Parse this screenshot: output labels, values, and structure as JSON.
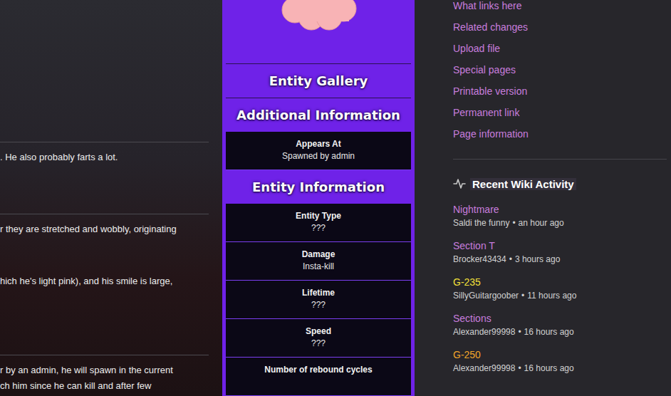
{
  "article": {
    "sections": [
      {
        "lines": [
          ". He also probably farts a lot."
        ]
      },
      {
        "lines": [
          "r they are stretched and wobbly, originating",
          "hich he's light pink), and his smile is large,"
        ]
      },
      {
        "lines": [
          "r by an admin, he will spawn in the current",
          "ch him since he can kill and after few"
        ]
      }
    ]
  },
  "infobox": {
    "gallery_title": "Entity Gallery",
    "sections": [
      {
        "title": "Additional Information",
        "rows": [
          {
            "label": "Appears At",
            "value": "Spawned by admin"
          }
        ]
      },
      {
        "title": "Entity Information",
        "rows": [
          {
            "label": "Entity Type",
            "value": "???"
          },
          {
            "label": "Damage",
            "value": "Insta-kill"
          },
          {
            "label": "Lifetime",
            "value": "???"
          },
          {
            "label": "Speed",
            "value": "???"
          },
          {
            "label": "Number of rebound cycles",
            "value": ""
          }
        ]
      }
    ]
  },
  "sidebar": {
    "tools": [
      "What links here",
      "Related changes",
      "Upload file",
      "Special pages",
      "Printable version",
      "Permanent link",
      "Page information"
    ],
    "recent": {
      "title": "Recent Wiki Activity",
      "separator": "•",
      "items": [
        {
          "title": "Nightmare",
          "user": "Saldi the funny",
          "time": "an hour ago",
          "color": "#c77dde"
        },
        {
          "title": "Section T",
          "user": "Brocker43434",
          "time": "3 hours ago",
          "color": "#c77dde"
        },
        {
          "title": "G-235",
          "user": "SillyGuitargoober",
          "time": "11 hours ago",
          "color": "#f3e03a"
        },
        {
          "title": "Sections",
          "user": "Alexander99998",
          "time": "16 hours ago",
          "color": "#c77dde"
        },
        {
          "title": "G-250",
          "user": "Alexander99998",
          "time": "16 hours ago",
          "color": "#f0a52a"
        }
      ]
    }
  }
}
